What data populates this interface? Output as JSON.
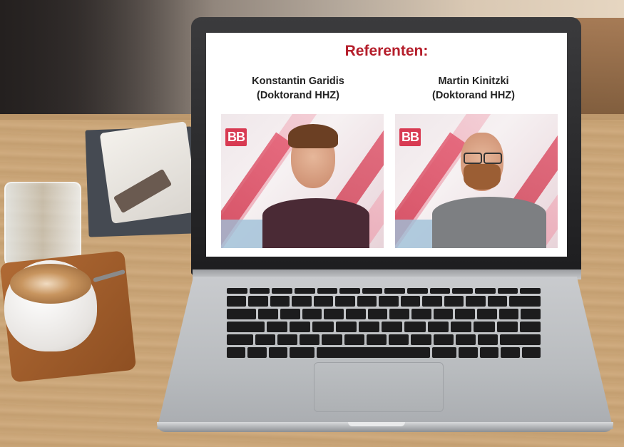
{
  "slide": {
    "title": "Referenten:",
    "speakers": [
      {
        "name": "Konstantin Garidis",
        "role": "(Doktorand HHZ)",
        "photo_logo": "BB"
      },
      {
        "name": "Martin Kinitzki",
        "role": "(Doktorand HHZ)",
        "photo_logo": "BB"
      }
    ]
  },
  "colors": {
    "title_red": "#b51e2b",
    "logo_red": "#d83a52"
  }
}
